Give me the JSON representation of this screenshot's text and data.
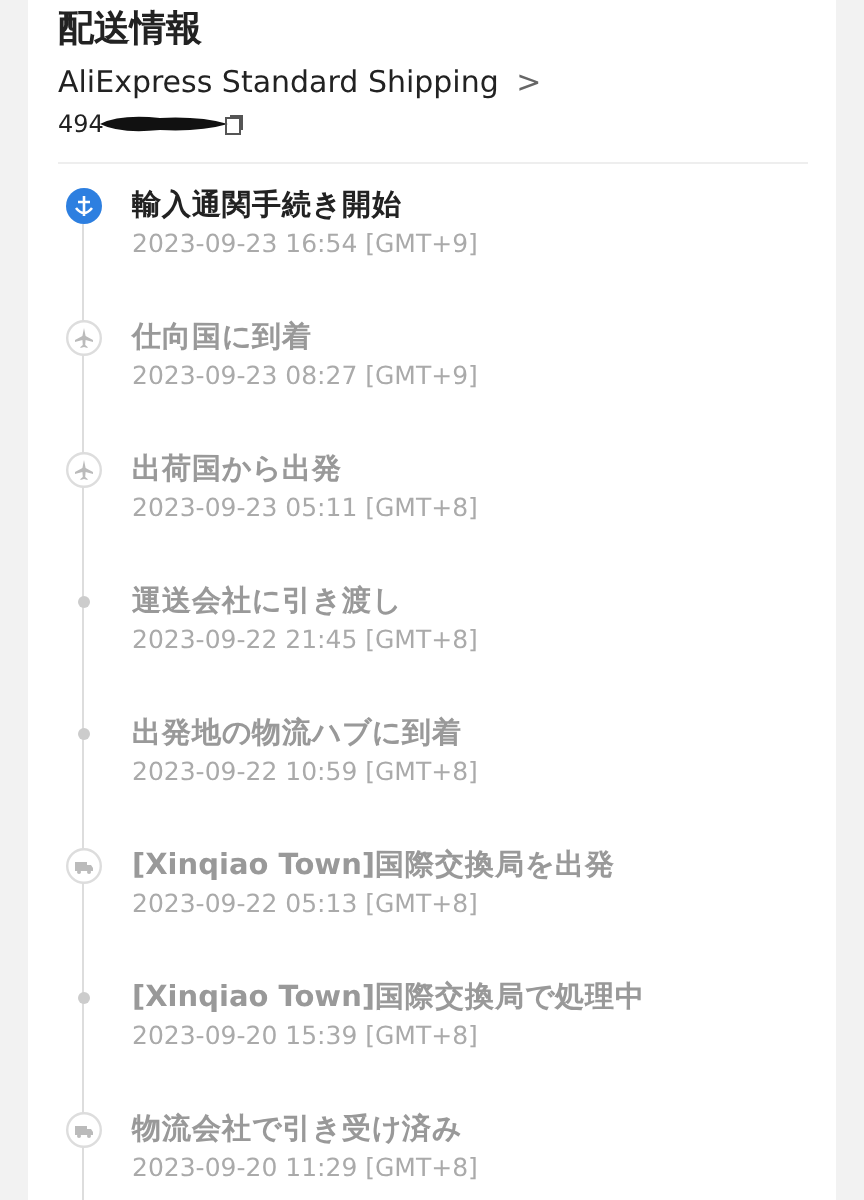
{
  "heading": "配送情報",
  "carrier": {
    "name": "AliExpress Standard Shipping",
    "chevron": ">"
  },
  "tracking": {
    "number": "494"
  },
  "events": [
    {
      "kind": "active",
      "title": "輸入通関手続き開始",
      "time": "2023-09-23 16:54 [GMT+9]"
    },
    {
      "kind": "plane",
      "title": "仕向国に到着",
      "time": "2023-09-23 08:27 [GMT+9]"
    },
    {
      "kind": "plane",
      "title": "出荷国から出発",
      "time": "2023-09-23 05:11 [GMT+8]"
    },
    {
      "kind": "dot",
      "title": "運送会社に引き渡し",
      "time": "2023-09-22 21:45 [GMT+8]"
    },
    {
      "kind": "dot",
      "title": "出発地の物流ハブに到着",
      "time": "2023-09-22 10:59 [GMT+8]"
    },
    {
      "kind": "truck",
      "title": "[Xinqiao Town]国際交換局を出発",
      "time": "2023-09-22 05:13 [GMT+8]"
    },
    {
      "kind": "dot",
      "title": "[Xinqiao Town]国際交換局で処理中",
      "time": "2023-09-20 15:39 [GMT+8]"
    },
    {
      "kind": "truck",
      "title": "物流会社で引き受け済み",
      "time": "2023-09-20 11:29 [GMT+8]"
    }
  ]
}
